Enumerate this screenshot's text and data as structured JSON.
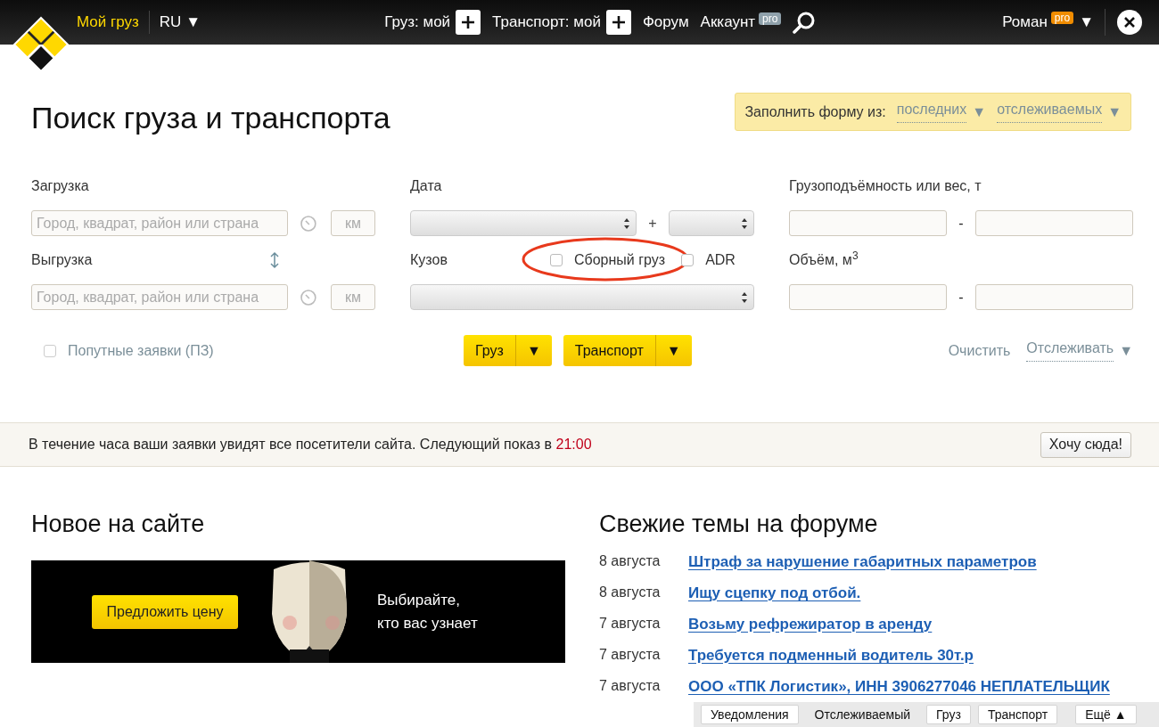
{
  "top_bar": {
    "brand_link": "Мой груз",
    "language": {
      "label": "RU",
      "caret": "▼"
    },
    "nav": [
      {
        "kind": "add",
        "label": "Груз: мой"
      },
      {
        "kind": "add",
        "label": "Транспорт: мой"
      },
      {
        "kind": "link",
        "label": "Форум"
      },
      {
        "kind": "pro",
        "label": "Аккаунт",
        "badge": "pro"
      }
    ],
    "user": {
      "name": "Роман",
      "badge": "pro",
      "caret": "▼"
    }
  },
  "page_title": "Поиск груза и транспорта",
  "fill_form": {
    "label": "Заполнить форму из:",
    "options": [
      {
        "label": "последних",
        "caret": "▼"
      },
      {
        "label": "отслеживаемых",
        "caret": "▼"
      }
    ]
  },
  "form": {
    "loading": {
      "label": "Загрузка",
      "placeholder": "Город, квадрат, район или страна",
      "radius_placeholder": "км"
    },
    "unloading": {
      "label": "Выгрузка",
      "placeholder": "Город, квадрат, район или страна",
      "radius_placeholder": "км"
    },
    "date": {
      "label": "Дата",
      "plus": "+"
    },
    "body": {
      "label": "Кузов"
    },
    "checkboxes": [
      {
        "label": "Сборный груз",
        "checked": false,
        "highlighted": true
      },
      {
        "label": "ADR",
        "checked": false,
        "highlighted": false
      }
    ],
    "capacity": {
      "label": "Грузоподъёмность или вес, т",
      "separator": "-"
    },
    "volume": {
      "label": "Объём, м$^{3}$",
      "separator": "-"
    },
    "en_route": {
      "label": "Попутные заявки (ПЗ)",
      "checked": false
    },
    "search_buttons": [
      {
        "label": "Груз",
        "caret": "▼"
      },
      {
        "label": "Транспорт",
        "caret": "▼"
      }
    ],
    "clear": "Очистить",
    "track": {
      "label": "Отслеживать",
      "caret": "▼"
    }
  },
  "notice": {
    "text": "В течение часа ваши заявки увидят все посетители сайта. Следующий показ в ",
    "time": "21:00",
    "button": "Хочу сюда!"
  },
  "news": {
    "title": "Новое на сайте",
    "banner": {
      "kind": "picture",
      "button": "Предложить цену",
      "text": "Выбирайте, кто вас узнает"
    }
  },
  "forum": {
    "title": "Свежие темы на форуме",
    "topics": [
      {
        "date": "8 августа",
        "title": "Штраф за нарушение габаритных параметров"
      },
      {
        "date": "8 августа",
        "title": "Ищу сцепку под отбой."
      },
      {
        "date": "7 августа",
        "title": "Возьму рефрежиратор в аренду"
      },
      {
        "date": "7 августа",
        "title": "Требуется подменный водитель 30т.р"
      },
      {
        "date": "7 августа",
        "title": "ООО «ТПК Логистик», ИНН 3906277046 НЕПЛАТЕЛЬЩИК"
      }
    ]
  },
  "bottom_bar": [
    {
      "kind": "button",
      "label": "Уведомления"
    },
    {
      "kind": "text",
      "label": "Отслеживаемый"
    },
    {
      "kind": "button",
      "label": "Груз"
    },
    {
      "kind": "button",
      "label": "Транспорт"
    },
    {
      "kind": "button",
      "label": "Ещё ▲"
    }
  ]
}
